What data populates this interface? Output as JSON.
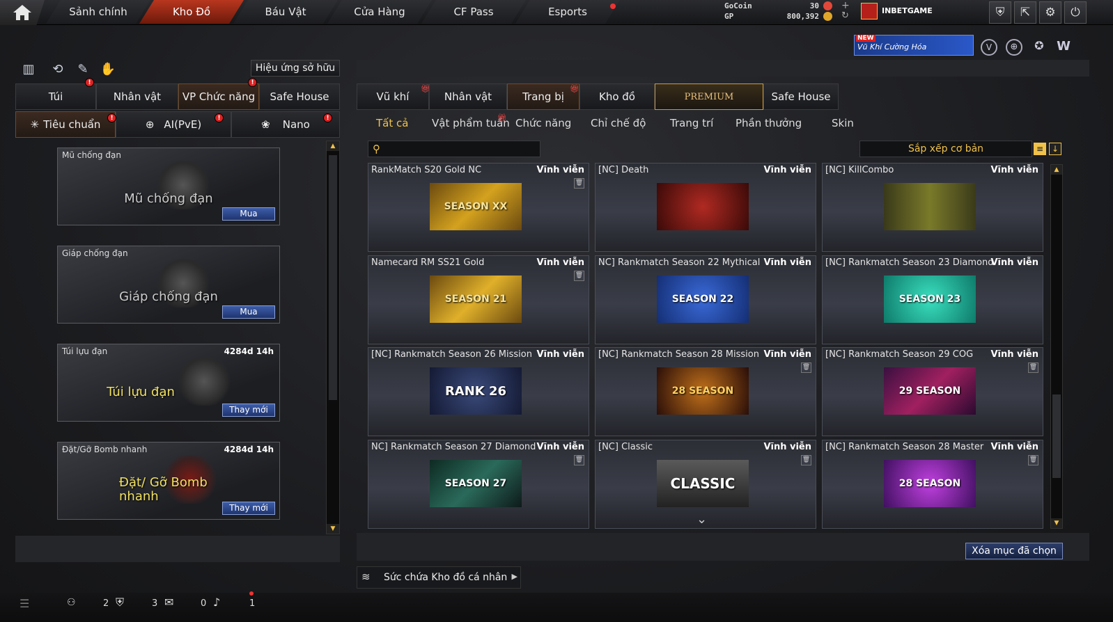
{
  "topnav": {
    "tabs": [
      "Sảnh chính",
      "Kho Đồ",
      "Báu Vật",
      "Cửa Hàng",
      "CF Pass",
      "Esports"
    ],
    "gocoin_label": "GoCoin",
    "gp_label": "GP",
    "gocoin": "30",
    "gp": "800,392",
    "username": "INBETGAME"
  },
  "banner": {
    "badge": "NEW",
    "text": "Vũ Khí Cường Hóa"
  },
  "left": {
    "effect_button": "Hiệu ứng sở hữu",
    "tabs": [
      "Túi",
      "Nhân vật",
      "VP Chức năng",
      "Safe House"
    ],
    "subtabs": [
      "Tiêu chuẩn",
      "AI(PvE)",
      "Nano"
    ],
    "items": [
      {
        "name": "Mũ chống đạn",
        "time": "",
        "art": "Mũ chống đạn",
        "action": "Mua"
      },
      {
        "name": "Giáp chống đạn",
        "time": "",
        "art": "Giáp chống đạn",
        "action": "Mua"
      },
      {
        "name": "Túi lựu đạn",
        "time": "4284d 14h",
        "art": "Túi lựu đạn",
        "action": "Thay mới"
      },
      {
        "name": "Đặt/Gỡ Bomb nhanh",
        "time": "4284d 14h",
        "art": "Đặt/ Gỡ Bomb nhanh",
        "action": "Thay mới"
      }
    ]
  },
  "right": {
    "tabs": [
      "Vũ khí",
      "Nhân vật",
      "Trang bị",
      "Kho đồ",
      "PREMIUM",
      "Safe House"
    ],
    "subtabs": [
      "Tất cả",
      "Vật phẩm tuần",
      "Chức năng",
      "Chỉ chế độ",
      "Trang trí",
      "Phần thưởng",
      "Skin"
    ],
    "sort_label": "Sắp xếp cơ bản",
    "items": [
      {
        "name": "RankMatch S20 Gold NC",
        "duration": "Vĩnh viễn",
        "art": "SEASON XX"
      },
      {
        "name": "[NC] Death",
        "duration": "Vĩnh viễn",
        "art": ""
      },
      {
        "name": "[NC] KillCombo",
        "duration": "Vĩnh viễn",
        "art": ""
      },
      {
        "name": "Namecard RM SS21 Gold",
        "duration": "Vĩnh viễn",
        "art": "SEASON 21"
      },
      {
        "name": "NC] Rankmatch Season 22 Mythical",
        "duration": "Vĩnh viễn",
        "art": "SEASON 22"
      },
      {
        "name": "[NC] Rankmatch Season 23 Diamond",
        "duration": "Vĩnh viễn",
        "art": "SEASON 23"
      },
      {
        "name": "[NC] Rankmatch Season 26 Mission",
        "duration": "Vĩnh viễn",
        "art": "RANK 26"
      },
      {
        "name": "[NC] Rankmatch Season 28 Mission",
        "duration": "Vĩnh viễn",
        "art": "28 SEASON"
      },
      {
        "name": "[NC] Rankmatch Season 29 COG",
        "duration": "Vĩnh viễn",
        "art": "29 SEASON"
      },
      {
        "name": "NC] Rankmatch Season 27 Diamond",
        "duration": "Vĩnh viễn",
        "art": "SEASON 27"
      },
      {
        "name": "[NC] Classic",
        "duration": "Vĩnh viễn",
        "art": "CLASSIC"
      },
      {
        "name": "[NC] Rankmatch Season 28 Master",
        "duration": "Vĩnh viễn",
        "art": "28 SEASON"
      }
    ],
    "delete_button": "Xóa mục đã chọn",
    "capacity_label": "Sức chứa Kho đồ cá nhân"
  },
  "statusbar": {
    "counts": [
      "2",
      "3",
      "0",
      "1"
    ]
  },
  "colors": {
    "accent": "#f0c24a",
    "active_tab": "#b8361e",
    "buy": "#2b4a94"
  }
}
